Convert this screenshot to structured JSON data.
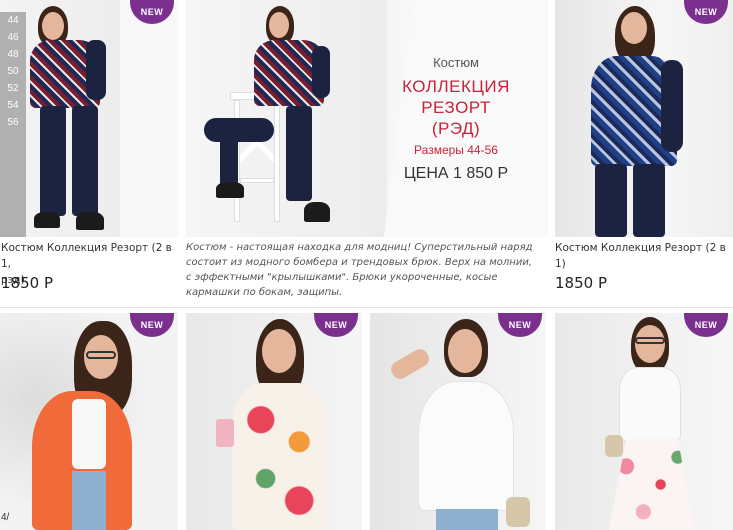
{
  "badge": "NEW",
  "sizes": [
    "44",
    "46",
    "48",
    "50",
    "52",
    "54",
    "56"
  ],
  "products": [
    {
      "title_line1": "Костюм Коллекция Резорт (2 в 1,",
      "title_line2": "рэд)",
      "price": "1850 Р"
    },
    {
      "title_line1": "Костюм Коллекция Резорт (2 в 1)",
      "price": "1850 Р"
    }
  ],
  "promo": {
    "label": "Костюм",
    "line1": "КОЛЛЕКЦИЯ",
    "line2": "РЕЗОРТ",
    "line3": "(РЭД)",
    "sizes": "Размеры 44-56",
    "price": "ЦЕНА 1 850 Р"
  },
  "description": "Костюм - настоящая находка для модниц! Суперстильный наряд состоит из модного бомбера и трендовых брюк. Верх на молнии, с эффектными \"крылышками\". Брюки укороченные, косые кармашки по бокам, защипы.",
  "edge_text": "4/",
  "colors": {
    "badge": "#7b2f8f",
    "promo_red": "#c7243a"
  }
}
